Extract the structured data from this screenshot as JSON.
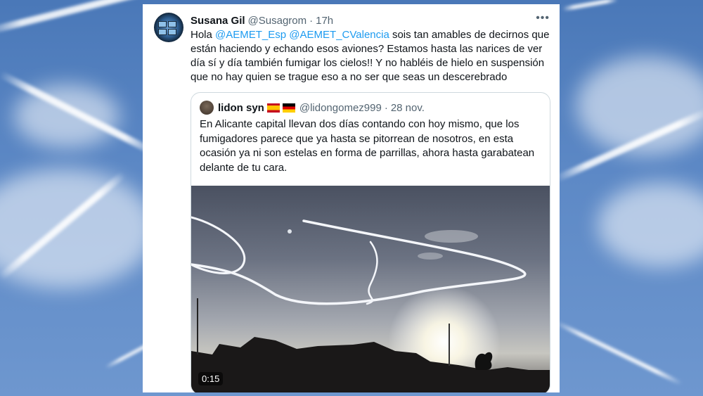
{
  "tweet": {
    "author_name": "Susana Gil",
    "author_handle": "@Susagrom",
    "separator": "·",
    "time": "17h",
    "more_label": "•••",
    "text_parts": {
      "hola": "Hola ",
      "mention1": "@AEMET_Esp",
      "space": " ",
      "mention2": "@AEMET_CValencia",
      "rest": " sois tan amables de decirnos que están haciendo y echando esos aviones? Estamos hasta las narices de ver día sí y día también fumigar los cielos!! Y no habléis de hielo en suspensión que no hay quien se trague eso a no ser que seas un descerebrado"
    }
  },
  "quote": {
    "author_name": "lidon syn",
    "author_handle": "@lidongomez999",
    "separator": "·",
    "date": "28 nov.",
    "flags": [
      "spain-flag",
      "germany-flag"
    ],
    "text": "En Alicante capital llevan dos días contando con hoy mismo, que los fumigadores parece que ya hasta se pitorrean de nosotros, en esta ocasión ya ni son estelas en forma de parrillas, ahora hasta garabatean delante de tu cara.",
    "video": {
      "duration": "0:15"
    }
  },
  "colors": {
    "link": "#1d9bf0",
    "text": "#0f1419",
    "muted": "#536471",
    "border": "#cfd9de"
  }
}
